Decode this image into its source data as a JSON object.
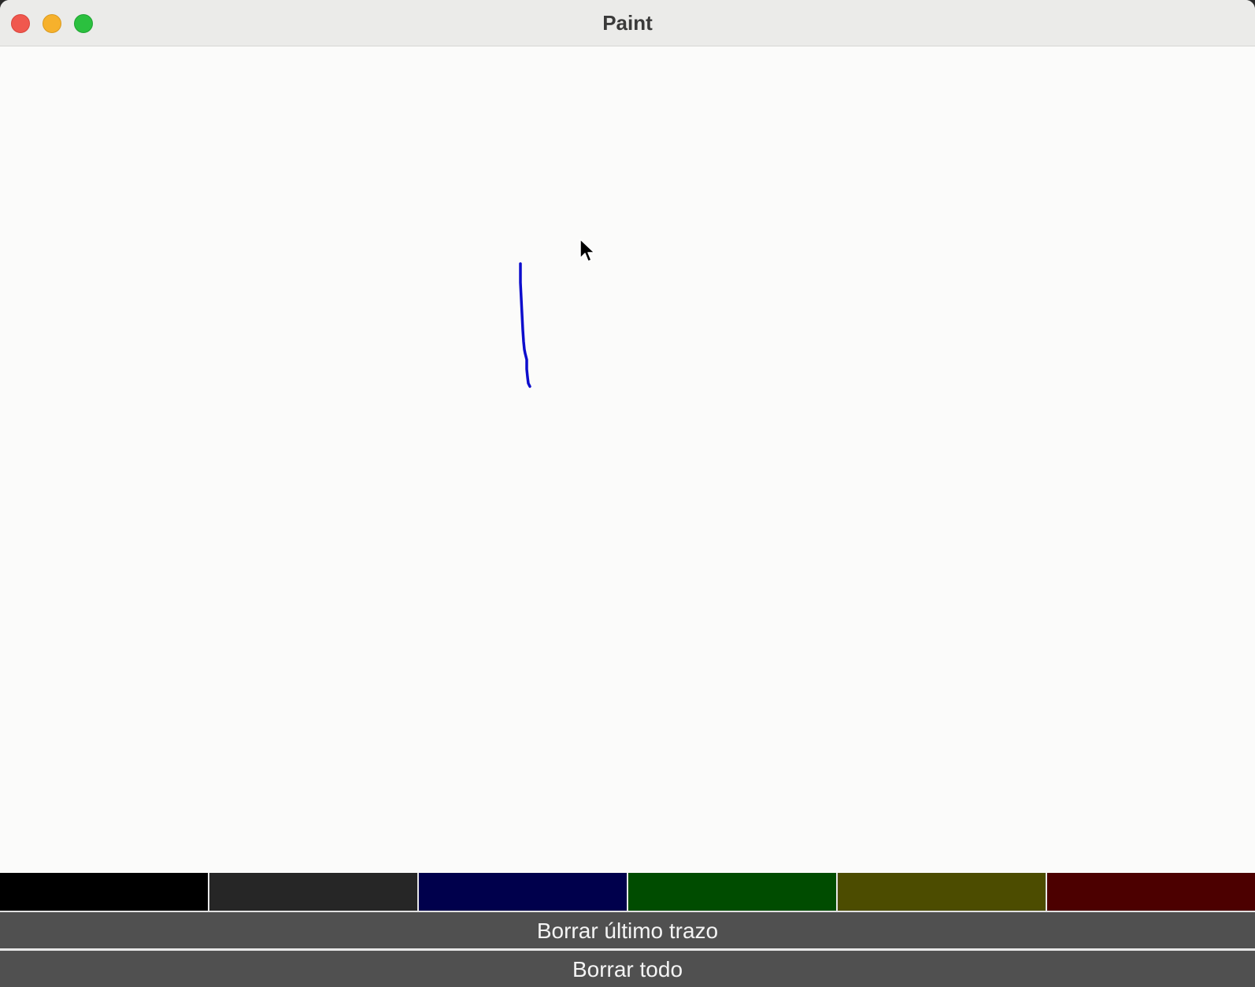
{
  "window": {
    "title": "Paint"
  },
  "canvas": {
    "stroke": {
      "color": "#0d0dcc"
    }
  },
  "palette": {
    "swatches": [
      {
        "color": "#000000"
      },
      {
        "color": "#262626"
      },
      {
        "color": "#00004c"
      },
      {
        "color": "#004c00"
      },
      {
        "color": "#4c4c00"
      },
      {
        "color": "#4c0000"
      }
    ]
  },
  "actions": {
    "undo_label": "Borrar último trazo",
    "clear_label": "Borrar todo"
  }
}
